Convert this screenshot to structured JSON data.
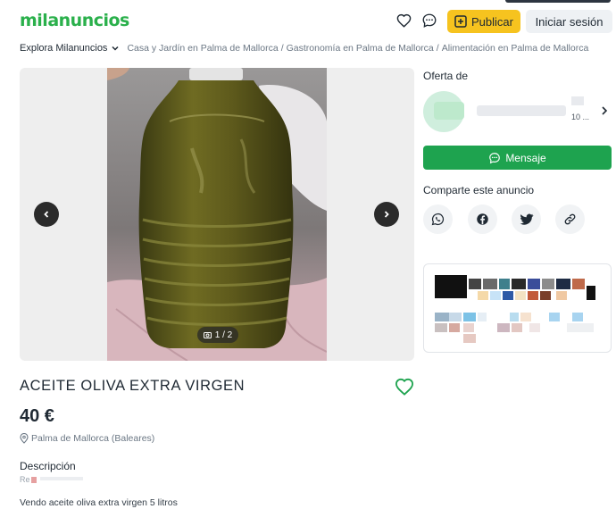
{
  "header": {
    "logo": "milanuncios",
    "publish_label": "Publicar",
    "login_label": "Iniciar sesión"
  },
  "breadcrumb": {
    "explore_label": "Explora Milanuncios",
    "items": [
      "Casa y Jardín en Palma de Mallorca",
      "Gastronomía en Palma de Mallorca",
      "Alimentación en Palma de Mallorca"
    ]
  },
  "gallery": {
    "counter": "1 / 2"
  },
  "seller_panel": {
    "offer_label": "Oferta de",
    "seller_meta": "10 ...",
    "message_label": "Mensaje",
    "share_label": "Comparte este anuncio",
    "share_icons": [
      "whatsapp-icon",
      "facebook-icon",
      "twitter-icon",
      "link-icon"
    ]
  },
  "listing": {
    "title": "ACEITE OLIVA EXTRA VIRGEN",
    "price": "40 €",
    "location": "Palma de Mallorca (Baleares)",
    "description_title": "Descripción",
    "ref": "Re",
    "description": "Vendo aceite oliva extra virgen 5 litros"
  },
  "colors": {
    "brand_green": "#2ab04b",
    "message_green": "#1ea34f",
    "publish_yellow": "#f6c31f"
  }
}
